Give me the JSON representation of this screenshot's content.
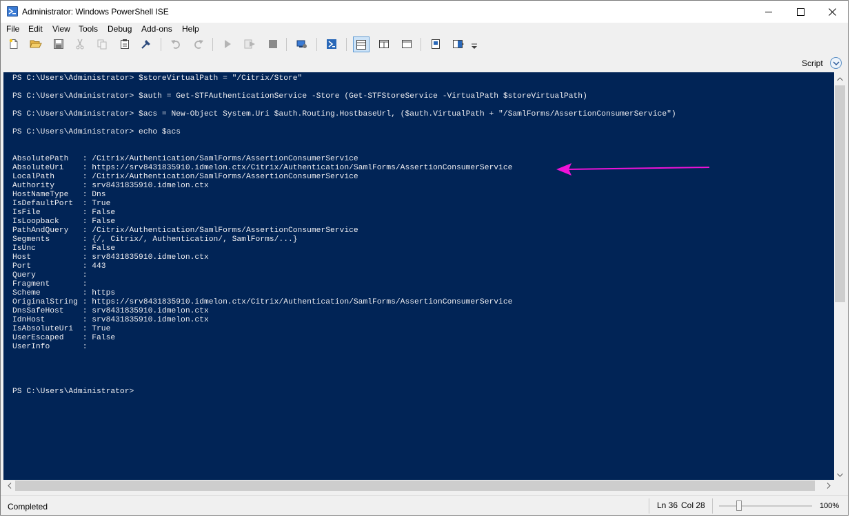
{
  "window": {
    "title": "Administrator: Windows PowerShell ISE",
    "minimize_icon": "minimize-icon",
    "maximize_icon": "maximize-icon",
    "close_icon": "close-icon"
  },
  "menu": [
    {
      "label": "File"
    },
    {
      "label": "Edit"
    },
    {
      "label": "View"
    },
    {
      "label": "Tools"
    },
    {
      "label": "Debug"
    },
    {
      "label": "Add-ons"
    },
    {
      "label": "Help"
    }
  ],
  "toolbar": {
    "buttons": [
      {
        "icon": "new-file-icon"
      },
      {
        "icon": "open-folder-icon"
      },
      {
        "icon": "save-icon"
      },
      {
        "icon": "cut-icon"
      },
      {
        "icon": "copy-icon"
      },
      {
        "icon": "paste-icon"
      },
      {
        "icon": "clear-console-icon"
      },
      {
        "icon": "undo-icon"
      },
      {
        "icon": "redo-icon"
      },
      {
        "icon": "run-script-icon"
      },
      {
        "icon": "run-selection-icon"
      },
      {
        "icon": "stop-icon"
      },
      {
        "icon": "remote-powershell-tab-icon"
      },
      {
        "icon": "start-powershell-icon"
      },
      {
        "icon": "show-script-top-icon"
      },
      {
        "icon": "show-script-right-icon"
      },
      {
        "icon": "show-script-maximized-icon"
      },
      {
        "icon": "show-command-window-icon"
      },
      {
        "icon": "show-command-addon-icon"
      }
    ],
    "overflow_icon": "toolbar-overflow-icon"
  },
  "script_pane": {
    "label": "Script",
    "toggle_icon": "chevron-down-icon"
  },
  "console": {
    "background": "#012456",
    "foreground": "#eeedf0",
    "lines": [
      "PS C:\\Users\\Administrator> $storeVirtualPath = \"/Citrix/Store\"",
      "",
      "PS C:\\Users\\Administrator> $auth = Get-STFAuthenticationService -Store (Get-STFStoreService -VirtualPath $storeVirtualPath)",
      "",
      "PS C:\\Users\\Administrator> $acs = New-Object System.Uri $auth.Routing.HostbaseUrl, ($auth.VirtualPath + \"/SamlForms/AssertionConsumerService\")",
      "",
      "PS C:\\Users\\Administrator> echo $acs",
      "",
      "",
      "AbsolutePath   : /Citrix/Authentication/SamlForms/AssertionConsumerService",
      "AbsoluteUri    : https://srv8431835910.idmelon.ctx/Citrix/Authentication/SamlForms/AssertionConsumerService",
      "LocalPath      : /Citrix/Authentication/SamlForms/AssertionConsumerService",
      "Authority      : srv8431835910.idmelon.ctx",
      "HostNameType   : Dns",
      "IsDefaultPort  : True",
      "IsFile         : False",
      "IsLoopback     : False",
      "PathAndQuery   : /Citrix/Authentication/SamlForms/AssertionConsumerService",
      "Segments       : {/, Citrix/, Authentication/, SamlForms/...}",
      "IsUnc          : False",
      "Host           : srv8431835910.idmelon.ctx",
      "Port           : 443",
      "Query          :",
      "Fragment       :",
      "Scheme         : https",
      "OriginalString : https://srv8431835910.idmelon.ctx/Citrix/Authentication/SamlForms/AssertionConsumerService",
      "DnsSafeHost    : srv8431835910.idmelon.ctx",
      "IdnHost        : srv8431835910.idmelon.ctx",
      "IsAbsoluteUri  : True",
      "UserEscaped    : False",
      "UserInfo       :",
      "",
      "",
      "",
      "",
      "PS C:\\Users\\Administrator>"
    ]
  },
  "annotation": {
    "arrow_color": "#f012d8",
    "arrow_icon": "arrow-left-icon"
  },
  "status": {
    "text": "Completed",
    "line": "Ln 36",
    "column": "Col 28",
    "zoom": "100%",
    "zoom_level": 1.0
  }
}
